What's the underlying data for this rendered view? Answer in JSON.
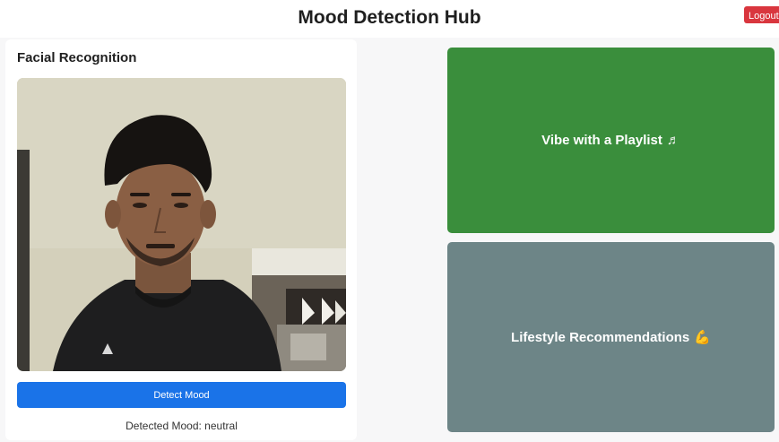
{
  "header": {
    "title": "Mood Detection Hub",
    "logout_label": "Logout"
  },
  "facial_recognition": {
    "title": "Facial Recognition",
    "camera_alt": "webcam feed",
    "detect_button_label": "Detect Mood",
    "detected_mood_text": "Detected Mood: neutral"
  },
  "tiles": {
    "playlist": {
      "label": "Vibe with a Playlist",
      "icon": "music-note-icon",
      "icon_glyph": "♬",
      "color": "#3a8e3c"
    },
    "lifestyle": {
      "label": "Lifestyle Recommendations",
      "icon": "flexed-bicep-icon",
      "icon_glyph": "💪",
      "color": "#6d8587"
    }
  },
  "colors": {
    "logout": "#d9363e",
    "primary_button": "#1a73e8"
  }
}
